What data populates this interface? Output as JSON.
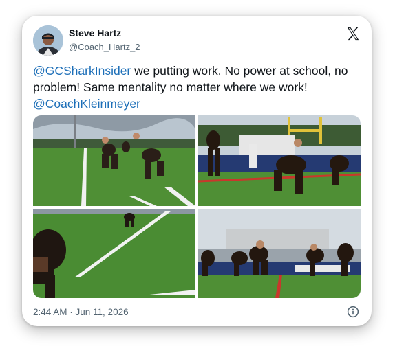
{
  "author": {
    "name": "Steve Hartz",
    "handle": "@Coach_Hartz_2"
  },
  "tweet": {
    "mention_1": "@GCSharkInsider",
    "text_1": " we putting work. No power at school, no problem! Same mentality no matter where we work!",
    "mention_2": "@CoachKleinmeyer"
  },
  "timestamp": "2:44 AM · Jun 11, 2026",
  "icons": {
    "brand": "x-logo-icon",
    "info": "info-icon"
  },
  "colors": {
    "mention": "#1d6fb8",
    "text": "#0f1419",
    "muted": "#536471"
  },
  "media": {
    "count": 4
  }
}
